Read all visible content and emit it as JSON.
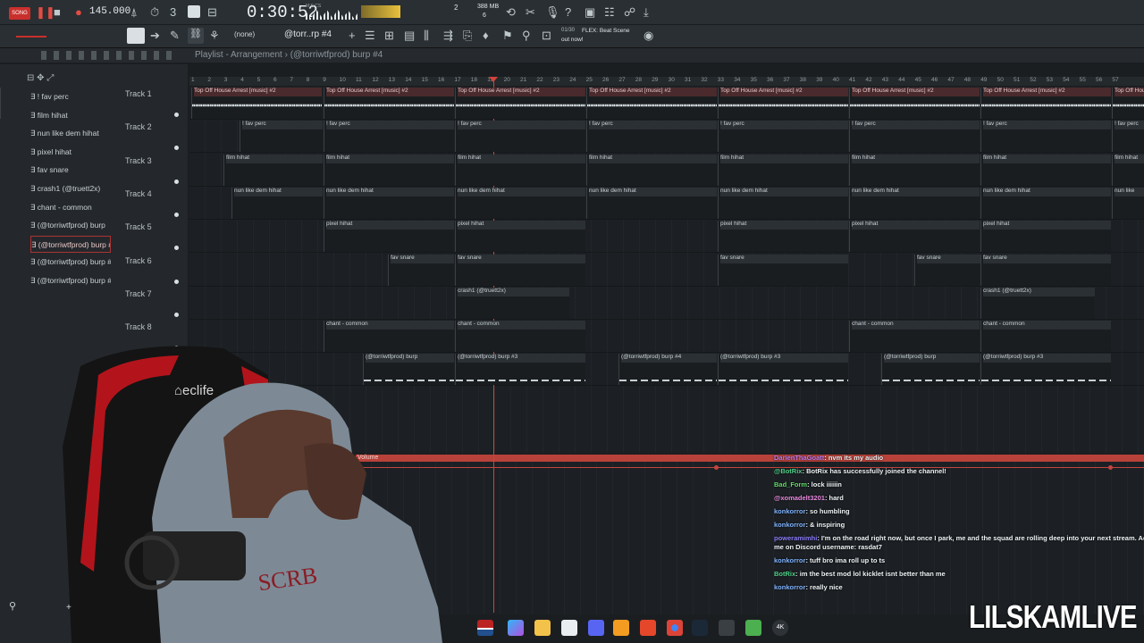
{
  "toolbar": {
    "song_mode": "SONG",
    "tempo": "145.000",
    "time": "0:30:52",
    "time_unit": "M:S:CS",
    "pattern_label": "2",
    "cpu_mem": "388 MB",
    "cpu_num": "6",
    "snap": "(none)",
    "pattern_name": "@torr..rp #4",
    "hint_line1": "01/30",
    "hint_line2": "FLEX: Beat Scene",
    "hint_line3": "out now!"
  },
  "playlist": {
    "title": "Playlist - Arrangement › (@torriwtfprod) burp #4"
  },
  "ruler": [
    "1",
    "2",
    "3",
    "4",
    "5",
    "6",
    "7",
    "8",
    "9",
    "10",
    "11",
    "12",
    "13",
    "14",
    "15",
    "16",
    "17",
    "18",
    "19",
    "20",
    "21",
    "22",
    "23",
    "24",
    "25",
    "26",
    "27",
    "28",
    "29",
    "30",
    "31",
    "32",
    "33",
    "34",
    "35",
    "36",
    "37",
    "38",
    "39",
    "40",
    "41",
    "42",
    "43",
    "44",
    "45",
    "46",
    "47",
    "48",
    "49",
    "50",
    "51",
    "52",
    "53",
    "54",
    "55",
    "56",
    "57"
  ],
  "picker": [
    {
      "label": "! fav perc"
    },
    {
      "label": "film hihat"
    },
    {
      "label": "nun like dem hihat"
    },
    {
      "label": "pixel hihat"
    },
    {
      "label": "fav snare"
    },
    {
      "label": "crash1 (@truett2x)"
    },
    {
      "label": "chant - common"
    },
    {
      "label": "(@torriwtfprod) burp"
    },
    {
      "label": "(@torriwtfprod) burp #4",
      "selected": true
    },
    {
      "label": "(@torriwtfprod) burp #2"
    },
    {
      "label": "(@torriwtfprod) burp #3"
    }
  ],
  "tracks": [
    {
      "name": "Track 1",
      "clips": [
        "Top Off  House Arrest [music] #2",
        "Top Off  House Arrest [music] #2",
        "Top Off  House Arrest [music] #2",
        "Top Off  House Arrest [music] #2",
        "Top Off  House Arrest [music] #2",
        "Top Off  House Arrest [music] #2",
        "Top Off  House Arrest [music] #2",
        "Top Off  House Arrest [music] #2",
        "Top Off"
      ]
    },
    {
      "name": "Track 2",
      "clips": [
        "! fav perc",
        "! fav perc",
        "! fav perc",
        "! fav perc",
        "! fav perc",
        "! fav perc",
        "! fav perc",
        "! fav perc"
      ]
    },
    {
      "name": "Track 3",
      "clips": [
        "film hihat",
        "film hihat",
        "film hihat",
        "film hihat",
        "film hihat",
        "film hihat",
        "film hihat",
        "film hihat"
      ]
    },
    {
      "name": "Track 4",
      "clips": [
        "nun like dem hihat",
        "nun like dem hihat",
        "nun like dem hihat",
        "nun like dem hihat",
        "nun like dem hihat",
        "nun like dem hihat",
        "nun like dem hihat",
        "nun like"
      ]
    },
    {
      "name": "Track 5",
      "clips": [
        "pixel hihat",
        "pixel hihat",
        "pixel hihat",
        "pixel hihat",
        "pixel hihat"
      ]
    },
    {
      "name": "Track 6",
      "clips": [
        "fav snare",
        "fav snare",
        "fav snare",
        "fav snare",
        "fav snare"
      ]
    },
    {
      "name": "Track 7",
      "clips": [
        "crash1 (@truett2x)",
        "crash1 (@truett2x)"
      ]
    },
    {
      "name": "Track 8",
      "clips": [
        "chant - common",
        "chant - common",
        "chant - common",
        "chant - common"
      ]
    },
    {
      "name": "",
      "clips": [
        "(@torriwtfprod) burp",
        "(@torriwtfprod) burp #3",
        "(@torriwtfprod) burp #4",
        "(@torriwtfprod) burp #3",
        "(@torriwtfprod) burp",
        "(@torriwtfprod) burp #3"
      ]
    }
  ],
  "automation": {
    "label": "Volume"
  },
  "chat": [
    {
      "user": "DarienThaGoatt",
      "text": ": nvm its my audio",
      "color": "#b57cf2"
    },
    {
      "user": "@BotRix",
      "text": ": BotRix has successfully joined the channel!",
      "color": "#51d08a"
    },
    {
      "user": "Bad_Form",
      "text": ": lock iiiiiin",
      "color": "#64d96a"
    },
    {
      "user": "@xomadelt3201",
      "text": ": hard",
      "color": "#e98be0"
    },
    {
      "user": "konkorror",
      "text": ": so humbling",
      "color": "#7fb3ff"
    },
    {
      "user": "konkorror",
      "text": ": & inspiring",
      "color": "#7fb3ff"
    },
    {
      "user": "poweramimhi",
      "text": ": I'm on the road right now, but once I park, me and the squad are rolling deep into your next stream. Add",
      "color": "#8a7cf7"
    },
    {
      "user": "",
      "text": "me on Discord username: rasdat7",
      "color": "#eef2f4"
    },
    {
      "user": "konkorror",
      "text": ": tuff bro ima roll up to ts",
      "color": "#7fb3ff"
    },
    {
      "user": "BotRix",
      "text": ": im the best mod lol kicklet isnt better than me",
      "color": "#51d08a"
    },
    {
      "user": "konkorror",
      "text": ": really nice",
      "color": "#7fb3ff"
    }
  ],
  "watermark": "LILSKAMLIVE",
  "colors": {
    "accent": "#d0443c",
    "clip_header": "#2b3034",
    "audio_clip": "#4a2a2c",
    "background": "#1b1e21"
  },
  "icons": [
    "play-icon",
    "stop-icon",
    "record-icon",
    "metronome-icon",
    "snap-icon",
    "pencil-icon",
    "brush-icon",
    "save-icon",
    "taskbar-icons"
  ]
}
